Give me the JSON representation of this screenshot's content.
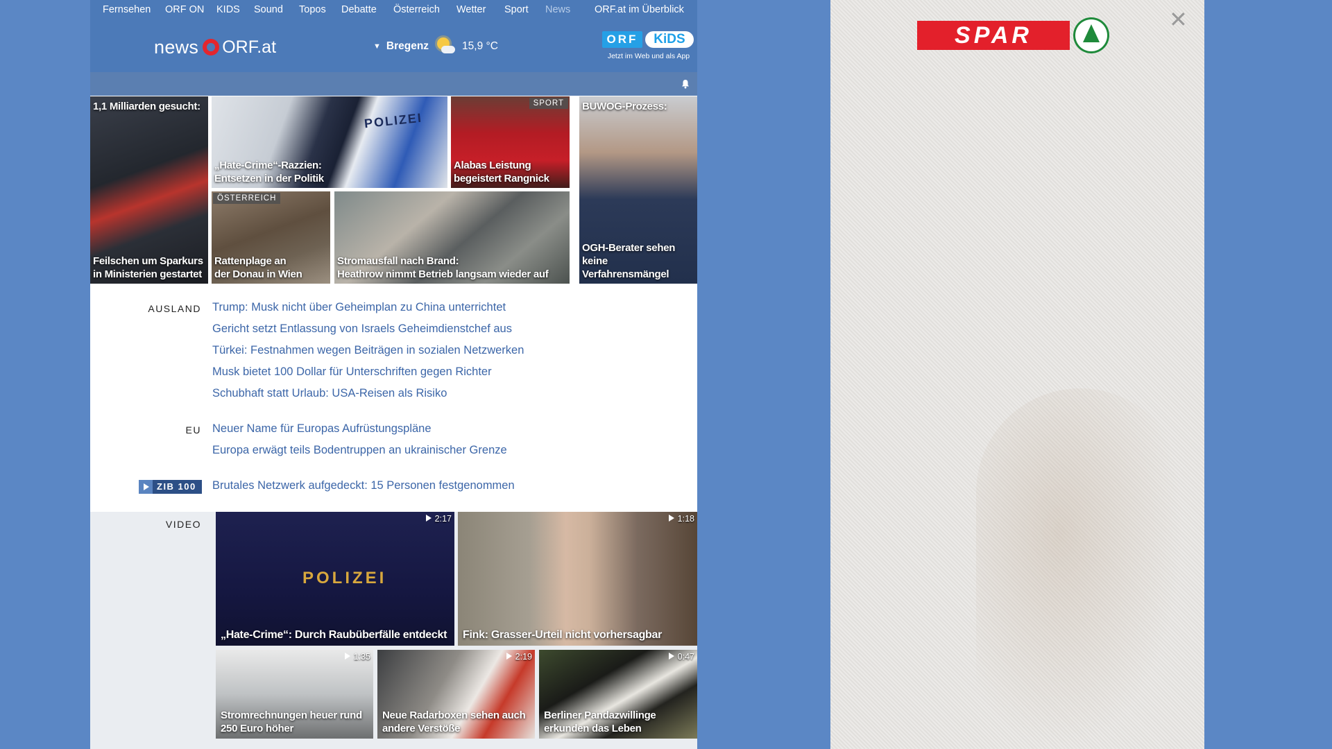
{
  "nav": {
    "items": [
      "Fernsehen",
      "ORF ON",
      "KIDS",
      "Sound",
      "Topos",
      "Debatte",
      "Österreich",
      "Wetter",
      "Sport",
      "News",
      "ORF.at im Überblick"
    ],
    "active": "News"
  },
  "header": {
    "logo_news": "news",
    "logo_site": "ORF.at",
    "weather": {
      "city": "Bregenz",
      "temp": "15,9 °C",
      "icon": "partly-sunny-icon"
    },
    "kids": {
      "orf": "ORF",
      "kids": "KiDS",
      "tagline": "Jetzt im Web und als App"
    }
  },
  "teasers": [
    {
      "kicker": "1,1 Milliarden gesucht:",
      "caption": "Feilschen um Sparkurs\nin Ministerien gestartet"
    },
    {
      "caption": "„Hate-Crime“-Razzien:\nEntsetzen in der Politik",
      "image_text": "POLIZEI"
    },
    {
      "label": "SPORT",
      "caption": "Alabas Leistung\nbegeistert Rangnick"
    },
    {
      "kicker": "BUWOG-Prozess:",
      "caption": "OGH-Berater sehen\nkeine Verfahrensmängel"
    },
    {
      "label": "ÖSTERREICH",
      "caption": "Rattenplage an\nder Donau in Wien"
    },
    {
      "caption": "Stromausfall nach Brand:\nHeathrow nimmt Betrieb langsam wieder auf"
    }
  ],
  "sections": [
    {
      "label": "AUSLAND",
      "headlines": [
        "Trump: Musk nicht über Geheimplan zu China unterrichtet",
        "Gericht setzt Entlassung von Israels Geheimdienstchef aus",
        "Türkei: Festnahmen wegen Beiträgen in sozialen Netzwerken",
        "Musk bietet 100 Dollar für Unterschriften gegen Richter",
        "Schubhaft statt Urlaub: USA-Reisen als Risiko"
      ]
    },
    {
      "label": "EU",
      "headlines": [
        "Neuer Name für Europas Aufrüstungspläne",
        "Europa erwägt teils Bodentruppen an ukrainischer Grenze"
      ]
    }
  ],
  "zib": {
    "badge": "ZIB 100",
    "headline": "Brutales Netzwerk aufgedeckt: 15 Personen festgenommen"
  },
  "video": {
    "label": "VIDEO",
    "items": [
      {
        "duration": "2:17",
        "caption": "„Hate-Crime“: Durch Raubüberfälle entdeckt",
        "image_text": "POLIZEI"
      },
      {
        "duration": "1:18",
        "caption": "Fink: Grasser-Urteil nicht vorhersagbar"
      },
      {
        "duration": "1:35",
        "caption": "Stromrechnungen heuer rund 250 Euro höher"
      },
      {
        "duration": "2:19",
        "caption": "Neue Radarboxen sehen auch andere Verstöße"
      },
      {
        "duration": "0:47",
        "caption": "Berliner Pandazwillinge erkunden das Leben"
      }
    ]
  },
  "ad": {
    "brand": "SPAR",
    "close_icon": "close-icon"
  },
  "colors": {
    "background": "#5b87c5",
    "nav": "#4c7ab8",
    "link": "#3c66a8",
    "spar_red": "#e3202b",
    "spar_green": "#1f8a3b"
  }
}
